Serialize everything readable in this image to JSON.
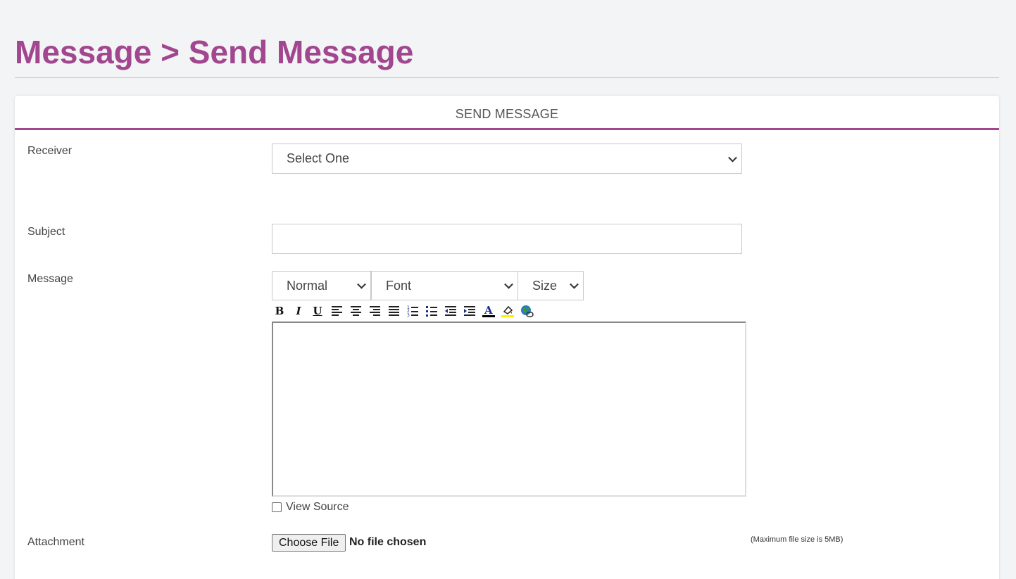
{
  "page": {
    "title": "Message > Send Message"
  },
  "card": {
    "header": "SEND MESSAGE"
  },
  "form": {
    "receiver_label": "Receiver",
    "receiver_value": "Select One",
    "subject_label": "Subject",
    "subject_value": "",
    "message_label": "Message",
    "attachment_label": "Attachment"
  },
  "editor": {
    "format_value": "Normal",
    "font_value": "Font",
    "size_value": "Size",
    "toolbar": [
      {
        "name": "bold-icon",
        "glyph": "B"
      },
      {
        "name": "italic-icon",
        "glyph": "I"
      },
      {
        "name": "underline-icon",
        "glyph": "U"
      },
      {
        "name": "align-left-icon",
        "glyph": ""
      },
      {
        "name": "align-center-icon",
        "glyph": ""
      },
      {
        "name": "align-right-icon",
        "glyph": ""
      },
      {
        "name": "align-justify-icon",
        "glyph": ""
      },
      {
        "name": "ordered-list-icon",
        "glyph": ""
      },
      {
        "name": "unordered-list-icon",
        "glyph": ""
      },
      {
        "name": "outdent-icon",
        "glyph": ""
      },
      {
        "name": "indent-icon",
        "glyph": ""
      },
      {
        "name": "text-color-icon",
        "glyph": "A"
      },
      {
        "name": "highlight-color-icon",
        "glyph": ""
      },
      {
        "name": "insert-link-icon",
        "glyph": ""
      }
    ],
    "view_source_label": "View Source"
  },
  "attachment": {
    "button_label": "Choose File",
    "status": "No file chosen",
    "note": "(Maximum file size is 5MB)"
  },
  "colors": {
    "accent": "#a1468f",
    "background": "#f2f4f5"
  }
}
